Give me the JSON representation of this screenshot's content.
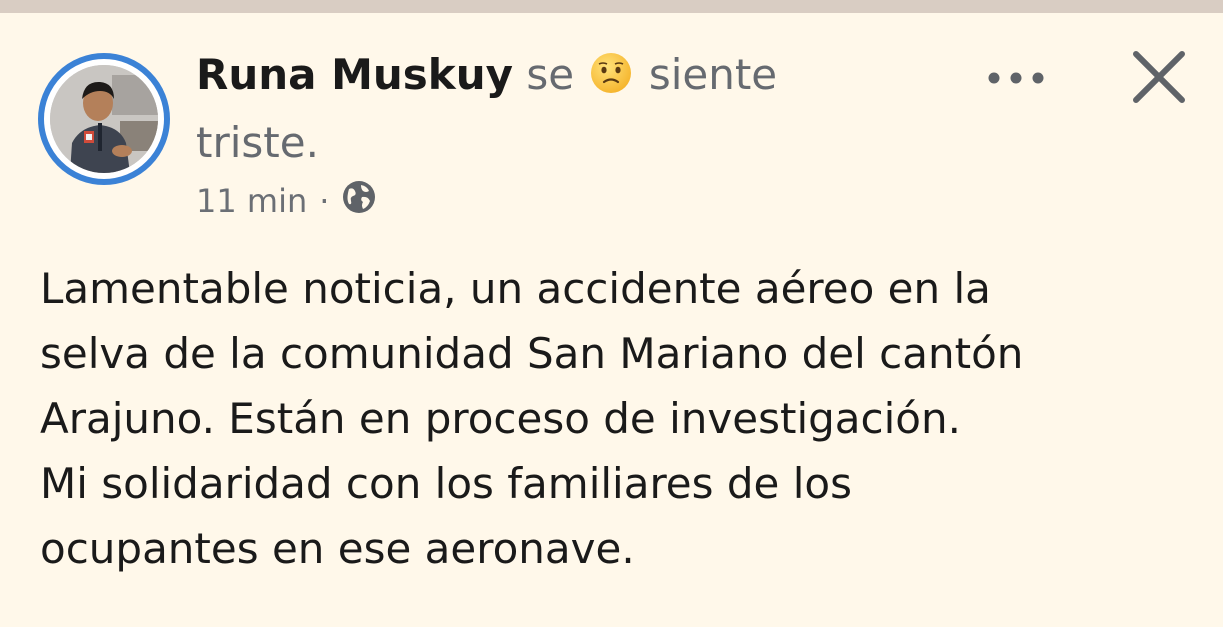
{
  "post": {
    "author": "Runa Muskuy",
    "feeling_prefix": "se",
    "feeling_emoji": "sad-face-emoji",
    "feeling_word": "siente",
    "feeling_suffix": "triste.",
    "time": "11 min",
    "separator": "·",
    "privacy_icon": "globe-icon",
    "body_lines": [
      "Lamentable noticia, un accidente aéreo en la",
      "selva de la comunidad San Mariano del cantón",
      "Arajuno. Están en proceso de investigación.",
      "Mi solidaridad con los familiares de los",
      "ocupantes en ese aeronave."
    ]
  },
  "actions": {
    "more_icon": "more-options-icon",
    "close_icon": "close-icon"
  },
  "colors": {
    "background": "#fff8ea",
    "avatar_ring": "#3b82d6",
    "meta_text": "#6b6f75",
    "top_strip": "#d9cdc3"
  }
}
